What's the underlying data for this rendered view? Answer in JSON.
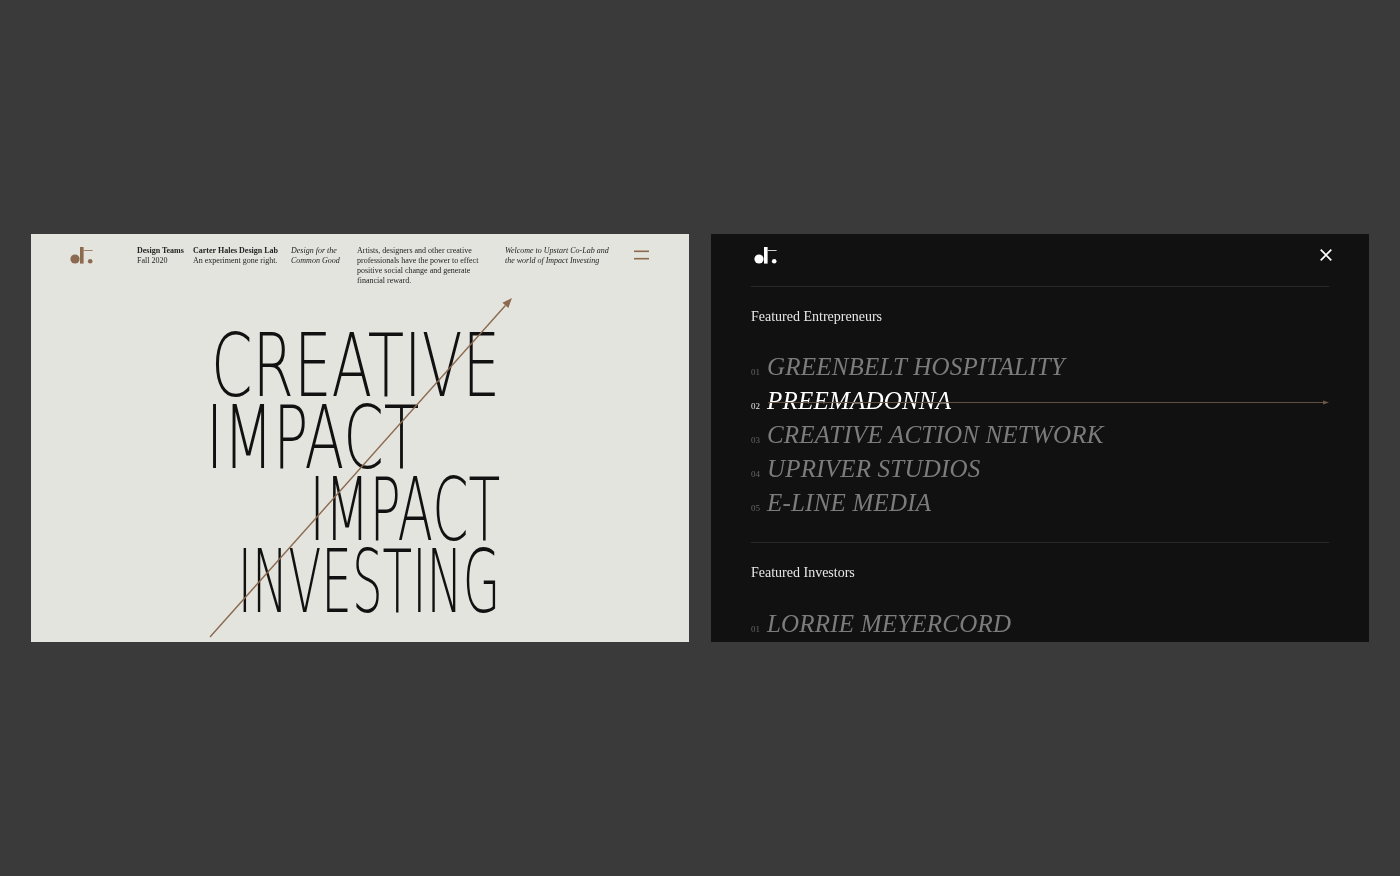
{
  "left_page": {
    "header": {
      "columns": [
        {
          "kind": "label",
          "title": "Design Teams",
          "subtitle": "Fall 2020"
        },
        {
          "kind": "label",
          "title": "Carter Hales Design Lab",
          "subtitle": "An experiment gone right."
        },
        {
          "kind": "italic",
          "text": "Design for the Common Good"
        },
        {
          "kind": "plain",
          "text": "Artists, designers and other creative professionals have the power to effect positive social change and generate financial reward."
        },
        {
          "kind": "italic",
          "text": "Welcome to Upstart Co-Lab and the world of Impact Investing"
        }
      ]
    },
    "hero": {
      "lines": [
        "CREATIVE",
        "IMPACT",
        "IMPACT",
        "INVESTING"
      ]
    }
  },
  "menu_panel": {
    "sections": [
      {
        "title": "Featured Entrepreneurs",
        "items": [
          {
            "number": "01",
            "name": "GREENBELT HOSPITALITY",
            "selected": false
          },
          {
            "number": "02",
            "name": "PREEMADONNA",
            "selected": true
          },
          {
            "number": "03",
            "name": "CREATIVE ACTION NETWORK",
            "selected": false
          },
          {
            "number": "04",
            "name": "UPRIVER STUDIOS",
            "selected": false
          },
          {
            "number": "05",
            "name": "E-LINE MEDIA",
            "selected": false
          }
        ]
      },
      {
        "title": "Featured Investors",
        "items": [
          {
            "number": "01",
            "name": "LORRIE MEYERCORD",
            "selected": false
          }
        ]
      }
    ]
  }
}
